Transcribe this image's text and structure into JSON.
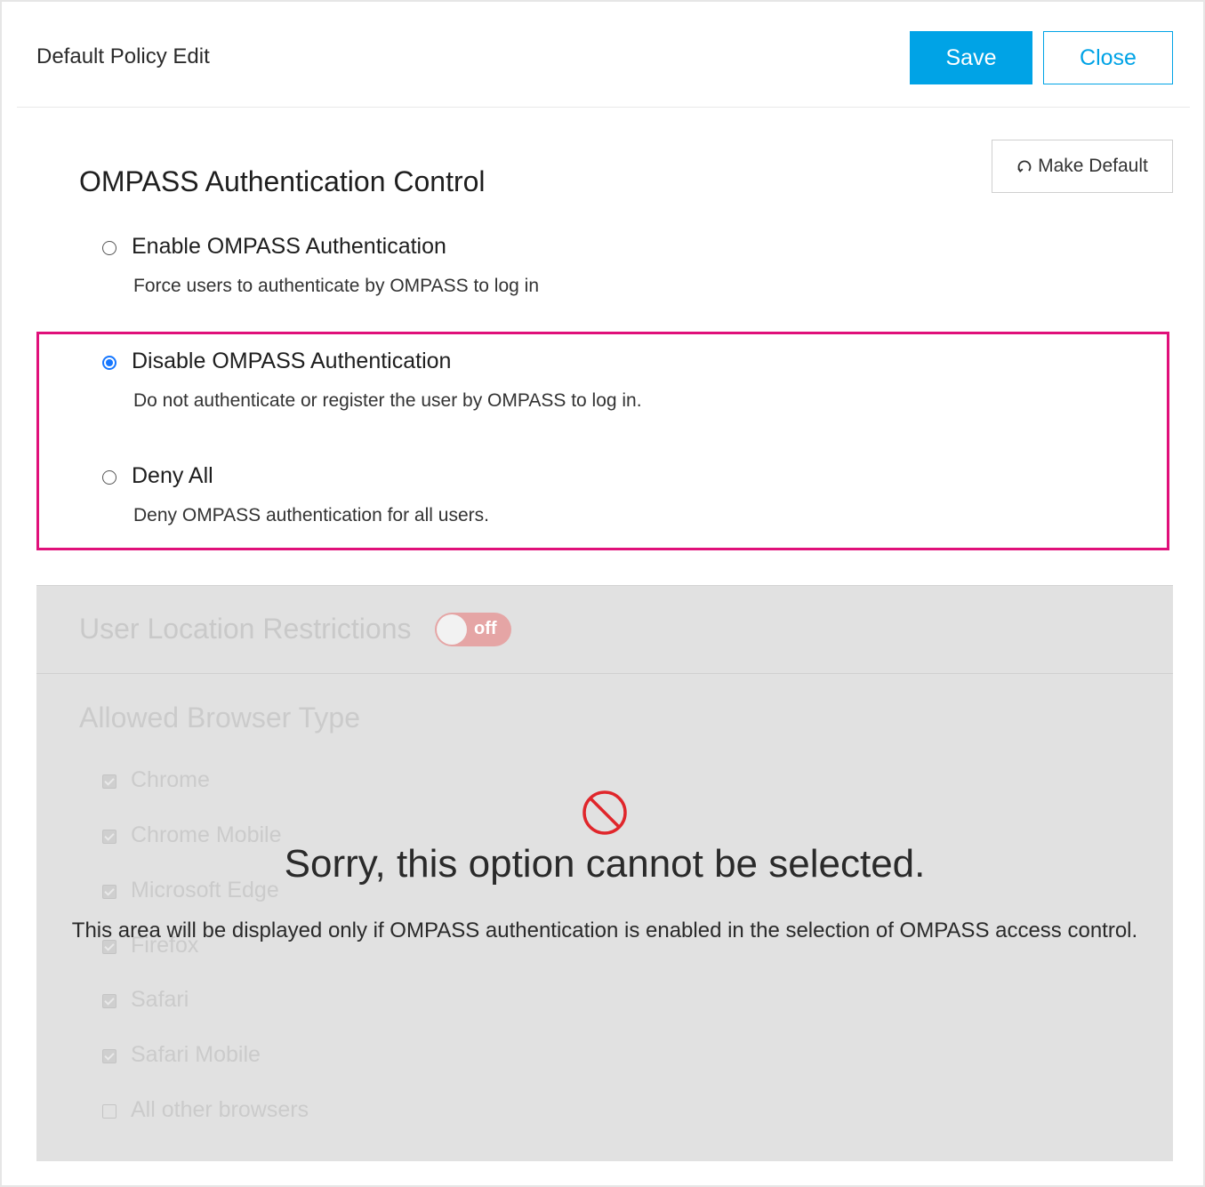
{
  "header": {
    "title": "Default Policy Edit",
    "save_label": "Save",
    "close_label": "Close"
  },
  "auth_control": {
    "title": "OMPASS Authentication Control",
    "make_default_label": "Make Default",
    "options": [
      {
        "label": "Enable OMPASS Authentication",
        "description": "Force users to authenticate by OMPASS to log in",
        "selected": false
      },
      {
        "label": "Disable OMPASS Authentication",
        "description": "Do not authenticate or register the user by OMPASS to log in.",
        "selected": true
      },
      {
        "label": "Deny All",
        "description": "Deny OMPASS authentication for all users.",
        "selected": false
      }
    ],
    "highlight_color": "#e0107a"
  },
  "location": {
    "title": "User Location Restrictions",
    "toggle_label": "off"
  },
  "browsers": {
    "title": "Allowed Browser Type",
    "items": [
      {
        "label": "Chrome",
        "checked": true
      },
      {
        "label": "Chrome Mobile",
        "checked": true
      },
      {
        "label": "Microsoft Edge",
        "checked": true
      },
      {
        "label": "Firefox",
        "checked": true
      },
      {
        "label": "Safari",
        "checked": true
      },
      {
        "label": "Safari Mobile",
        "checked": true
      },
      {
        "label": "All other browsers",
        "checked": false
      }
    ]
  },
  "overlay": {
    "icon": "block-icon",
    "heading": "Sorry, this option cannot be selected.",
    "message": "This area will be displayed only if OMPASS authentication is enabled in the selection of OMPASS access control."
  },
  "colors": {
    "primary": "#00a3e6",
    "radio_selected": "#1677ff",
    "block_icon": "#e0262b"
  }
}
